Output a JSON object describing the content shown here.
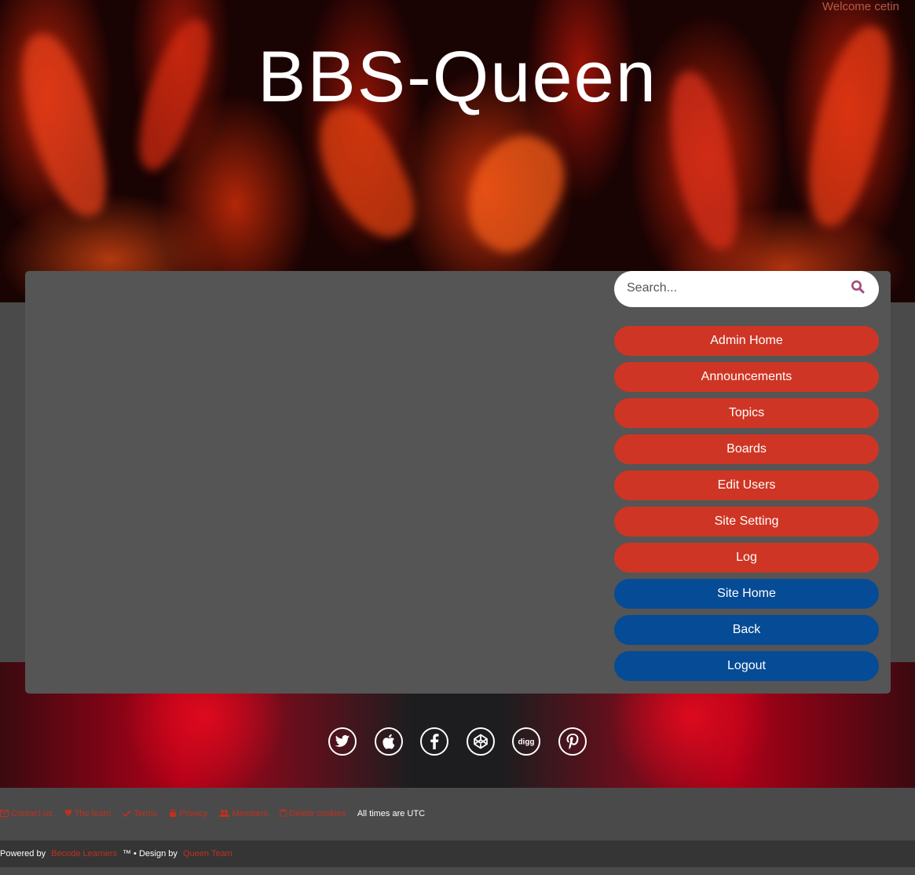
{
  "header": {
    "welcome_text": "Welcome cetin",
    "site_title": "BBS-Queen"
  },
  "search": {
    "placeholder": "Search...",
    "icon": "search-icon"
  },
  "menu": {
    "admin_home": "Admin Home",
    "announcements": "Announcements",
    "topics": "Topics",
    "boards": "Boards",
    "edit_users": "Edit Users",
    "site_setting": "Site Setting",
    "log": "Log",
    "site_home": "Site Home",
    "back": "Back",
    "logout": "Logout"
  },
  "social": [
    "twitter-icon",
    "apple-icon",
    "facebook-icon",
    "codepen-icon",
    "digg-icon",
    "pinterest-icon"
  ],
  "footer_links": {
    "contact": "Contact us",
    "team": "The team",
    "terms": "Terms",
    "privacy": "Privacy",
    "members": "Members",
    "delete_cookies": "Delete cookies",
    "timezone": "All times are UTC"
  },
  "bottom": {
    "powered_by": "Powered by",
    "powered_link": "Becode Learners",
    "design_sep": "™ • Design by",
    "design_link": "Queen Team"
  },
  "colors": {
    "menu_red": "#cf3524",
    "menu_blue": "#064b95",
    "link_red": "#c0301f"
  }
}
